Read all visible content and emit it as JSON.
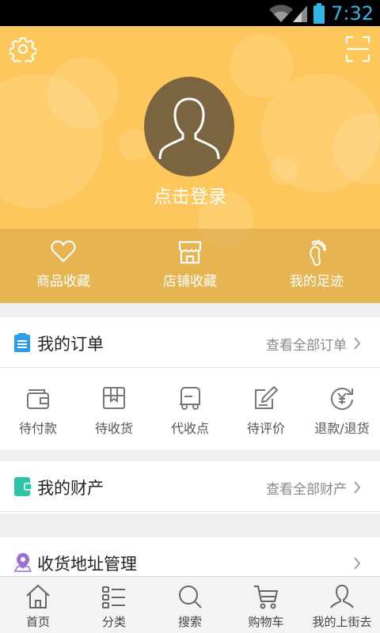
{
  "status_bar": {
    "time": "7:32"
  },
  "profile": {
    "login_text": "点击登录"
  },
  "favorites": [
    {
      "label": "商品收藏",
      "icon": "heart-icon"
    },
    {
      "label": "店铺收藏",
      "icon": "shop-icon"
    },
    {
      "label": "我的足迹",
      "icon": "footprint-icon"
    }
  ],
  "orders": {
    "title": "我的订单",
    "view_all": "查看全部订单",
    "items": [
      {
        "label": "待付款",
        "icon": "wallet-icon"
      },
      {
        "label": "待收货",
        "icon": "package-icon"
      },
      {
        "label": "代收点",
        "icon": "delivery-truck-icon"
      },
      {
        "label": "待评价",
        "icon": "edit-icon"
      },
      {
        "label": "退款/退货",
        "icon": "refund-icon"
      }
    ]
  },
  "assets": {
    "title": "我的财产",
    "view_all": "查看全部财产"
  },
  "address": {
    "title": "收货地址管理"
  },
  "bottom_nav": [
    {
      "label": "首页",
      "icon": "home-icon"
    },
    {
      "label": "分类",
      "icon": "category-list-icon"
    },
    {
      "label": "搜索",
      "icon": "search-icon"
    },
    {
      "label": "购物车",
      "icon": "cart-icon"
    },
    {
      "label": "我的上街去",
      "icon": "profile-icon"
    }
  ],
  "colors": {
    "header_bg": "#fdc75b",
    "order_icon_blue": "#2a9ee8",
    "asset_icon_green": "#2fc4a8",
    "address_icon_purple": "#9b6fd6",
    "status_time": "#33b5e5"
  }
}
